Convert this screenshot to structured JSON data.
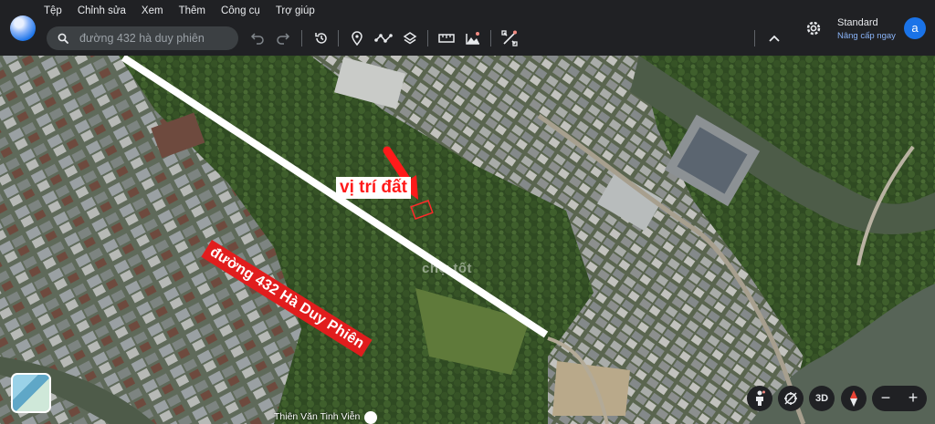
{
  "menu": [
    "Tệp",
    "Chỉnh sửa",
    "Xem",
    "Thêm",
    "Công cụ",
    "Trợ giúp"
  ],
  "search": {
    "placeholder": "đường 432 hà duy phiên"
  },
  "toolbar": {
    "icons": [
      "undo-icon",
      "redo-icon",
      "history-icon",
      "placemark-icon",
      "path-icon",
      "layers-icon",
      "ruler-icon",
      "image-overlay-icon",
      "satellite-tools-icon",
      "collapse-chevron-icon"
    ]
  },
  "account": {
    "plan": "Standard",
    "upgrade": "Nâng cấp ngay",
    "avatar_letter": "a"
  },
  "map": {
    "road_label": "đường 432 Hà Duy Phiên",
    "location_label": "vị trí đất",
    "watermark": "chợ tốt",
    "attribution": "Thiên Văn Tinh Viễn"
  },
  "controls": {
    "three_d": "3D",
    "zoom_out": "−",
    "zoom_in": "+"
  },
  "colors": {
    "header_bg": "#202124",
    "accent": "#8ab4f8",
    "road_label_bg": "#e11d1d",
    "arrow": "#ff1a1a",
    "avatar": "#1a73e8"
  }
}
